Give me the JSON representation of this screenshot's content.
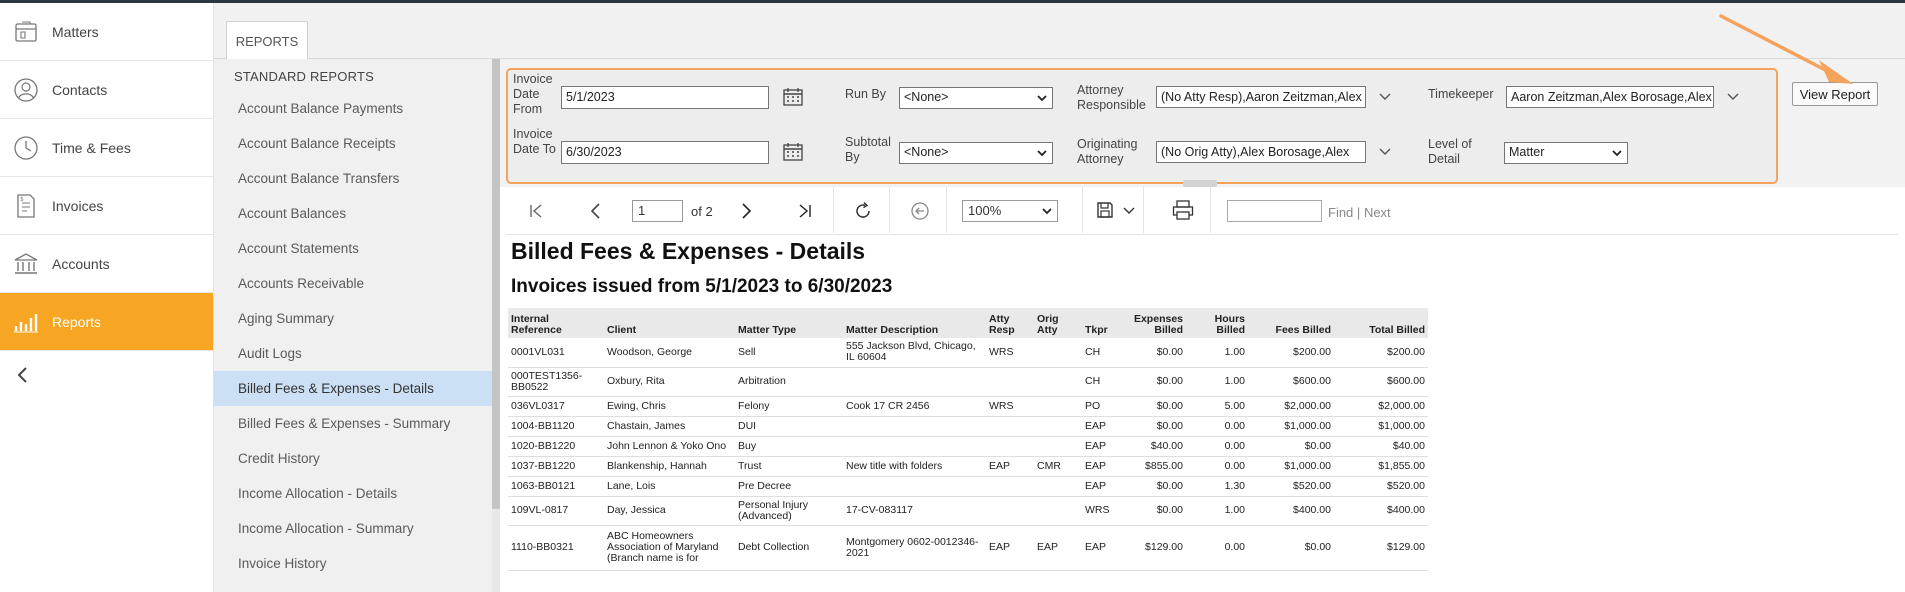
{
  "nav": {
    "items": [
      {
        "label": "Matters",
        "icon": "matters-icon"
      },
      {
        "label": "Contacts",
        "icon": "contacts-icon"
      },
      {
        "label": "Time & Fees",
        "icon": "clock-icon"
      },
      {
        "label": "Invoices",
        "icon": "invoice-icon"
      },
      {
        "label": "Accounts",
        "icon": "bank-icon"
      },
      {
        "label": "Reports",
        "icon": "bar-chart-icon",
        "active": true
      }
    ],
    "collapse_glyph": "‹"
  },
  "tab": {
    "label": "REPORTS"
  },
  "reports": {
    "header": "STANDARD REPORTS",
    "items": [
      "Account Balance Payments",
      "Account Balance Receipts",
      "Account Balance Transfers",
      "Account Balances",
      "Account Statements",
      "Accounts Receivable",
      "Aging Summary",
      "Audit Logs",
      "Billed Fees & Expenses - Details",
      "Billed Fees & Expenses - Summary",
      "Credit History",
      "Income Allocation - Details",
      "Income Allocation - Summary",
      "Invoice History"
    ],
    "active_index": 8
  },
  "params": {
    "date_from_label": "Invoice Date From",
    "date_from": "5/1/2023",
    "date_to_label": "Invoice Date To",
    "date_to": "6/30/2023",
    "run_by_label": "Run By",
    "run_by": "<None>",
    "subtotal_by_label": "Subtotal By",
    "subtotal_by": "<None>",
    "atty_resp_label": "Attorney Responsible",
    "atty_resp": "(No Atty Resp),Aaron Zeitzman,Alex Borosage",
    "orig_atty_label": "Originating Attorney",
    "orig_atty": "(No Orig Atty),Alex Borosage,Alex",
    "timekeeper_label": "Timekeeper",
    "timekeeper": "Aaron Zeitzman,Alex Borosage,Alex",
    "level_label": "Level of Detail",
    "level": "Matter",
    "view_report": "View Report",
    "accent_color": "#f5a25d"
  },
  "toolbar": {
    "page": "1",
    "of_text": "of 2",
    "zoom": "100%",
    "find": "Find",
    "sep": "|",
    "next": "Next"
  },
  "report": {
    "title": "Billed Fees & Expenses - Details",
    "subtitle": "Invoices issued from 5/1/2023 to 6/30/2023",
    "columns": [
      "Internal Reference",
      "Client",
      "Matter Type",
      "Matter Description",
      "Atty Resp",
      "Orig Atty",
      "Tkpr",
      "Expenses Billed",
      "Hours Billed",
      "Fees Billed",
      "Total Billed"
    ],
    "rows": [
      [
        "0001VL031",
        "Woodson, George",
        "Sell",
        "555 Jackson Blvd, Chicago, IL 60604",
        "WRS",
        "",
        "CH",
        "$0.00",
        "1.00",
        "$200.00",
        "$200.00"
      ],
      [
        "000TEST1356-BB0522",
        "Oxbury, Rita",
        "Arbitration",
        "",
        "",
        "",
        "CH",
        "$0.00",
        "1.00",
        "$600.00",
        "$600.00"
      ],
      [
        "036VL0317",
        "Ewing, Chris",
        "Felony",
        "Cook 17 CR 2456",
        "WRS",
        "",
        "PO",
        "$0.00",
        "5.00",
        "$2,000.00",
        "$2,000.00"
      ],
      [
        "1004-BB1120",
        "Chastain, James",
        "DUI",
        "",
        "",
        "",
        "EAP",
        "$0.00",
        "0.00",
        "$1,000.00",
        "$1,000.00"
      ],
      [
        "1020-BB1220",
        "John Lennon & Yoko Ono",
        "Buy",
        "",
        "",
        "",
        "EAP",
        "$40.00",
        "0.00",
        "$0.00",
        "$40.00"
      ],
      [
        "1037-BB1220",
        "Blankenship, Hannah",
        "Trust",
        "New title with folders",
        "EAP",
        "CMR",
        "EAP",
        "$855.00",
        "0.00",
        "$1,000.00",
        "$1,855.00"
      ],
      [
        "1063-BB0121",
        "Lane, Lois",
        "Pre Decree",
        "",
        "",
        "",
        "EAP",
        "$0.00",
        "1.30",
        "$520.00",
        "$520.00"
      ],
      [
        "109VL-0817",
        "Day, Jessica",
        "Personal Injury (Advanced)",
        "17-CV-083117",
        "",
        "",
        "WRS",
        "$0.00",
        "1.00",
        "$400.00",
        "$400.00"
      ],
      [
        "1110-BB0321",
        "ABC Homeowners Association of Maryland (Branch name is for",
        "Debt Collection",
        "Montgomery 0602-0012346-2021",
        "EAP",
        "EAP",
        "EAP",
        "$129.00",
        "0.00",
        "$0.00",
        "$129.00"
      ]
    ]
  }
}
